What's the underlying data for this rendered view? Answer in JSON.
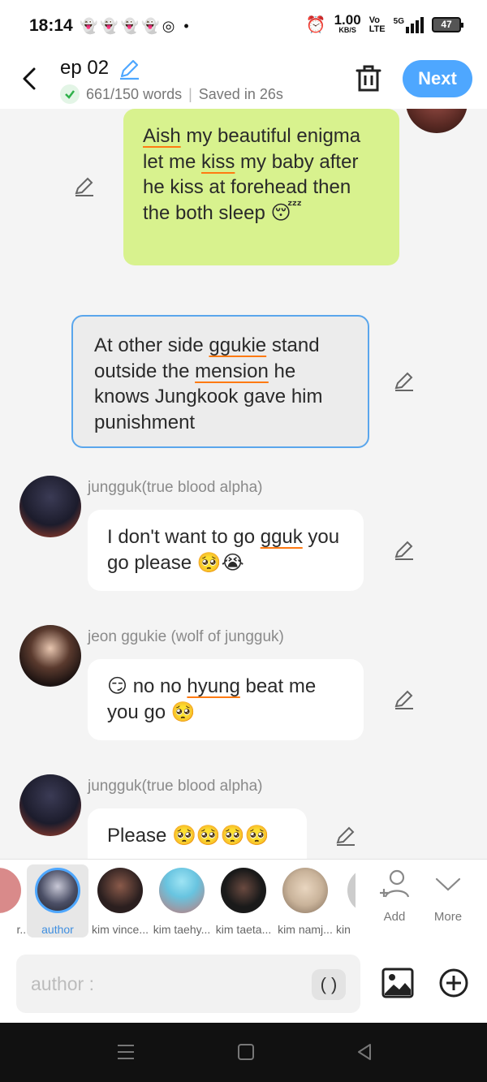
{
  "status_bar": {
    "time": "18:14",
    "net_speed_value": "1.00",
    "net_speed_unit": "KB/S",
    "volte_top": "Vo",
    "volte_bottom": "LTE",
    "network": "5G",
    "battery": "47"
  },
  "header": {
    "title": "ep 02",
    "word_count": "661/150 words",
    "saved_status": "Saved in 26s",
    "next_label": "Next"
  },
  "messages": [
    {
      "type": "author",
      "text_parts": [
        "",
        "Aish",
        " my beautiful enigma let me ",
        "kiss",
        " my baby after he kiss at forehead then the both sleep 😴"
      ]
    },
    {
      "type": "narration",
      "text_parts": [
        "At other side ",
        "ggukie",
        " stand outside the ",
        "mension",
        " he knows Jungkook gave him punishment"
      ]
    },
    {
      "type": "character",
      "name": "jungguk(true blood alpha)",
      "text_parts": [
        "I don't want to go ",
        "gguk",
        " you go please 🥺😭"
      ]
    },
    {
      "type": "character",
      "name": "jeon ggukie (wolf of jungguk)",
      "text_parts": [
        "😏 no no ",
        "hyung",
        " beat me you go 🥺"
      ]
    },
    {
      "type": "character",
      "name": "jungguk(true blood alpha)",
      "text_parts": [
        "Please 🥺🥺🥺🥺"
      ]
    }
  ],
  "characters": [
    {
      "label": "r...",
      "color": "#d98a8a"
    },
    {
      "label": "author",
      "color": "#4b4f66",
      "selected": true
    },
    {
      "label": "kim vince...",
      "color": "#2b1f1f"
    },
    {
      "label": "kim taehy...",
      "color": "#68c4e0"
    },
    {
      "label": "kim taeta...",
      "color": "#1a1a1a"
    },
    {
      "label": "kim namj...",
      "color": "#c9b39a"
    },
    {
      "label": "kin",
      "color": "#cccccc"
    }
  ],
  "strip_actions": {
    "add_label": "Add",
    "more_label": "More"
  },
  "input": {
    "placeholder": "author :",
    "paren_label": "( )"
  }
}
